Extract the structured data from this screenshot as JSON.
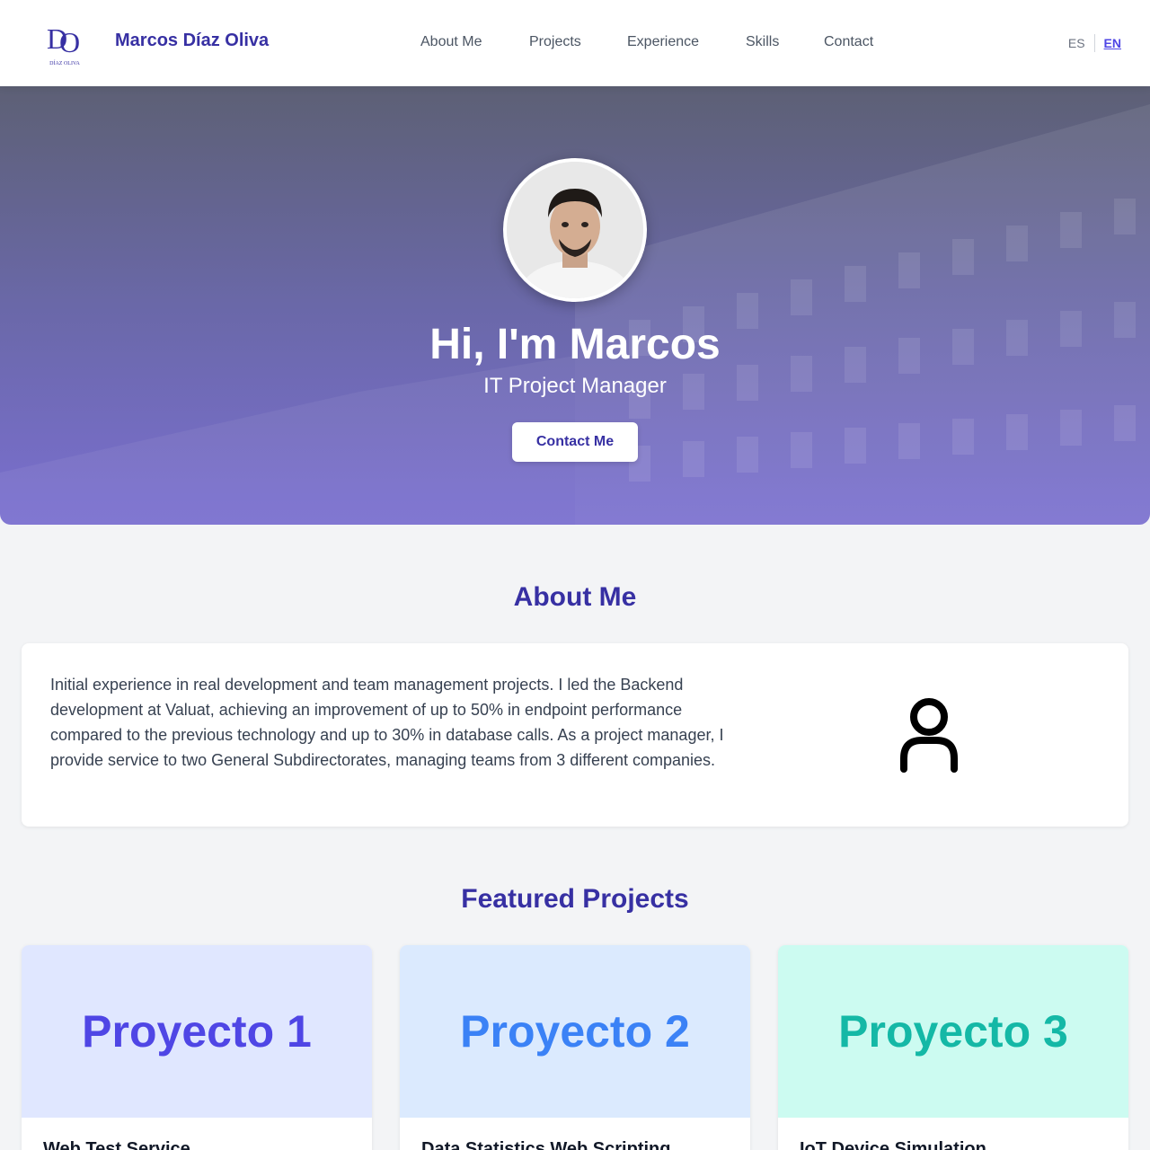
{
  "header": {
    "brand_name": "Marcos Díaz Oliva",
    "logo_text": "DÍAZ OLIVA",
    "nav": [
      {
        "label": "About Me"
      },
      {
        "label": "Projects"
      },
      {
        "label": "Experience"
      },
      {
        "label": "Skills"
      },
      {
        "label": "Contact"
      }
    ],
    "lang": {
      "es": "ES",
      "en": "EN",
      "active": "EN"
    }
  },
  "hero": {
    "title": "Hi, I'm Marcos",
    "subtitle": "IT Project Manager",
    "cta_label": "Contact Me"
  },
  "about": {
    "title": "About Me",
    "text": "Initial experience in real development and team management projects. I led the Backend development at Valuat, achieving an improvement of up to 50% in endpoint performance compared to the previous technology and up to 30% in database calls. As a project manager, I provide service to two General Subdirectorates, managing teams from 3 different companies.",
    "icon": "user-icon"
  },
  "projects": {
    "title": "Featured Projects",
    "items": [
      {
        "banner": "Proyecto 1",
        "name": "Web Test Service"
      },
      {
        "banner": "Proyecto 2",
        "name": "Data Statistics Web Scripting"
      },
      {
        "banner": "Proyecto 3",
        "name": "IoT Device Simulation"
      }
    ]
  },
  "colors": {
    "accent": "#3730a3",
    "project1": "#4f46e5",
    "project2": "#3b82f6",
    "project3": "#14b8a6"
  }
}
